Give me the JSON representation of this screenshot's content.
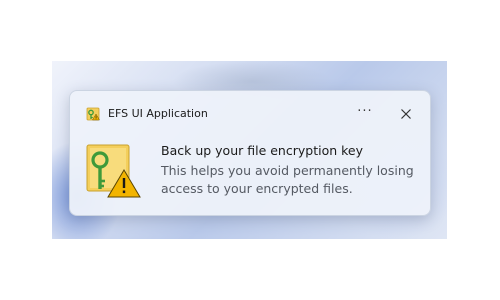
{
  "notification": {
    "app_name": "EFS UI Application",
    "app_icon": "key-lock-icon",
    "title": "Back up your file encryption key",
    "body": "This helps you avoid permanently losing access to your encrypted files.",
    "more_options_label": "···",
    "close_icon": "close-icon",
    "main_icon": "key-warning-icon"
  },
  "colors": {
    "accent_warning": "#f2b400",
    "key_green": "#4aa341",
    "folder_yellow": "#f4cf5c"
  }
}
